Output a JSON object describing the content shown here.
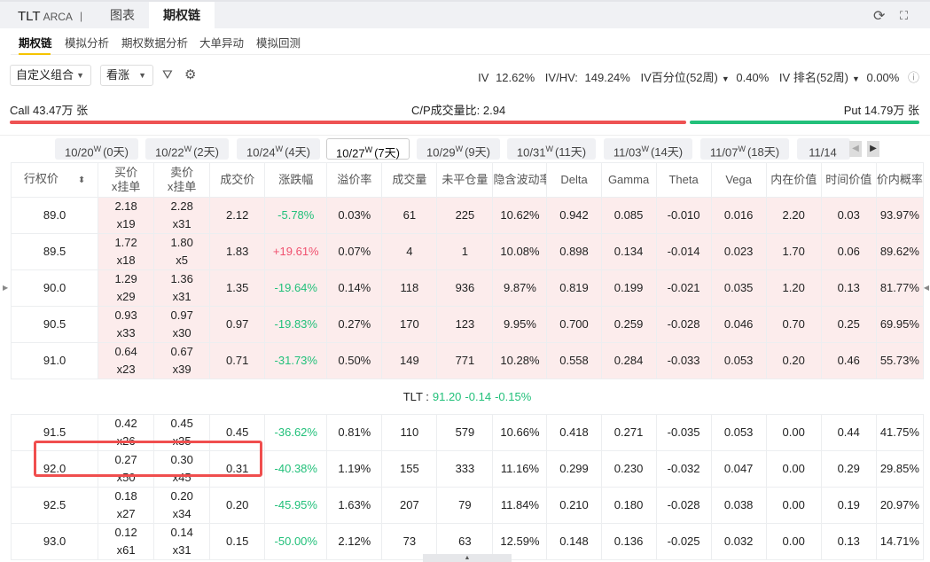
{
  "header": {
    "symbol": "TLT",
    "exchange": "ARCA",
    "separator": "|",
    "tabs": [
      "图表",
      "期权链"
    ]
  },
  "subnav": [
    "期权链",
    "模拟分析",
    "期权数据分析",
    "大单异动",
    "模拟回测"
  ],
  "toolbar": {
    "combo": "自定义组合",
    "direction": "看涨"
  },
  "stats": {
    "iv_label": "IV",
    "iv": "12.62%",
    "ivhv_label": "IV/HV:",
    "ivhv": "149.24%",
    "ivpct_label": "IV百分位(52周)",
    "ivpct": "0.40%",
    "ivrank_label": "IV 排名(52周)",
    "ivrank": "0.00%"
  },
  "cp": {
    "call": "Call 43.47万 张",
    "ratio": "C/P成交量比: 2.94",
    "put": "Put 14.79万 张",
    "call_fraction": 0.746
  },
  "colors": {
    "up": "#f0506e",
    "down": "#22c07a",
    "call_bar": "#ee5253",
    "put_bar": "#22c07a",
    "highlight": "#f04e4e"
  },
  "dates": [
    {
      "d": "10/20",
      "w": "W",
      "days": "(0天)"
    },
    {
      "d": "10/22",
      "w": "W",
      "days": "(2天)"
    },
    {
      "d": "10/24",
      "w": "W",
      "days": "(4天)"
    },
    {
      "d": "10/27",
      "w": "W",
      "days": "(7天)"
    },
    {
      "d": "10/29",
      "w": "W",
      "days": "(9天)"
    },
    {
      "d": "10/31",
      "w": "W",
      "days": "(11天)"
    },
    {
      "d": "11/03",
      "w": "W",
      "days": "(14天)"
    },
    {
      "d": "11/07",
      "w": "W",
      "days": "(18天)"
    },
    {
      "d": "11/14",
      "w": "",
      "days": ""
    }
  ],
  "columns": [
    "行权价",
    "买价\nx挂单",
    "卖价\nx挂单",
    "成交价",
    "涨跌幅",
    "溢价率",
    "成交量",
    "未平仓量",
    "隐含波动率",
    "Delta",
    "Gamma",
    "Theta",
    "Vega",
    "内在价值",
    "时间价值",
    "价内概率"
  ],
  "rows_itm": [
    [
      "89.0",
      "2.18",
      "x19",
      "2.28",
      "x31",
      "2.12",
      "-5.78%",
      "0.03%",
      "61",
      "225",
      "10.62%",
      "0.942",
      "0.085",
      "-0.010",
      "0.016",
      "2.20",
      "0.03",
      "93.97%"
    ],
    [
      "89.5",
      "1.72",
      "x18",
      "1.80",
      "x5",
      "1.83",
      "+19.61%",
      "0.07%",
      "4",
      "1",
      "10.08%",
      "0.898",
      "0.134",
      "-0.014",
      "0.023",
      "1.70",
      "0.06",
      "89.62%"
    ],
    [
      "90.0",
      "1.29",
      "x29",
      "1.36",
      "x31",
      "1.35",
      "-19.64%",
      "0.14%",
      "118",
      "936",
      "9.87%",
      "0.819",
      "0.199",
      "-0.021",
      "0.035",
      "1.20",
      "0.13",
      "81.77%"
    ],
    [
      "90.5",
      "0.93",
      "x33",
      "0.97",
      "x30",
      "0.97",
      "-19.83%",
      "0.27%",
      "170",
      "123",
      "9.95%",
      "0.700",
      "0.259",
      "-0.028",
      "0.046",
      "0.70",
      "0.25",
      "69.95%"
    ],
    [
      "91.0",
      "0.64",
      "x23",
      "0.67",
      "x39",
      "0.71",
      "-31.73%",
      "0.50%",
      "149",
      "771",
      "10.28%",
      "0.558",
      "0.284",
      "-0.033",
      "0.053",
      "0.20",
      "0.46",
      "55.73%"
    ]
  ],
  "spot": {
    "label": "TLT :",
    "price": "91.20",
    "change": "-0.14",
    "pct": "-0.15%"
  },
  "rows_otm": [
    [
      "91.5",
      "0.42",
      "x26",
      "0.45",
      "x35",
      "0.45",
      "-36.62%",
      "0.81%",
      "110",
      "579",
      "10.66%",
      "0.418",
      "0.271",
      "-0.035",
      "0.053",
      "0.00",
      "0.44",
      "41.75%"
    ],
    [
      "92.0",
      "0.27",
      "x50",
      "0.30",
      "x45",
      "0.31",
      "-40.38%",
      "1.19%",
      "155",
      "333",
      "11.16%",
      "0.299",
      "0.230",
      "-0.032",
      "0.047",
      "0.00",
      "0.29",
      "29.85%"
    ],
    [
      "92.5",
      "0.18",
      "x27",
      "0.20",
      "x34",
      "0.20",
      "-45.95%",
      "1.63%",
      "207",
      "79",
      "11.84%",
      "0.210",
      "0.180",
      "-0.028",
      "0.038",
      "0.00",
      "0.19",
      "20.97%"
    ],
    [
      "93.0",
      "0.12",
      "x61",
      "0.14",
      "x31",
      "0.15",
      "-50.00%",
      "2.12%",
      "73",
      "63",
      "12.59%",
      "0.148",
      "0.136",
      "-0.025",
      "0.032",
      "0.00",
      "0.13",
      "14.71%"
    ]
  ]
}
